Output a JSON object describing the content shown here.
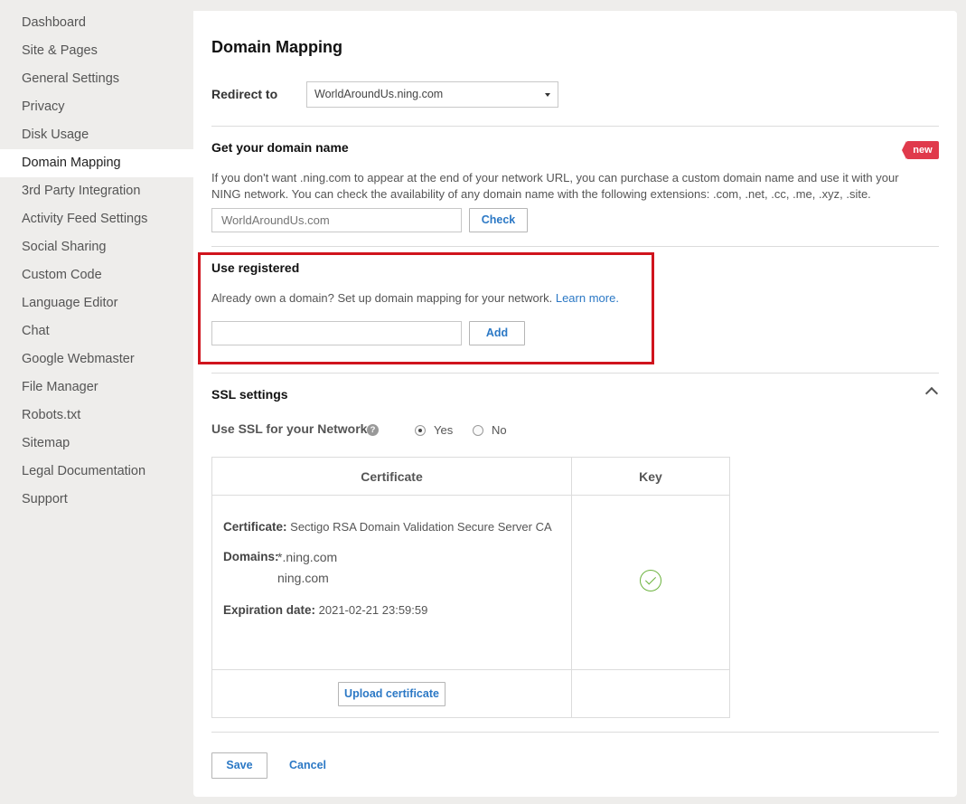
{
  "sidebar": {
    "items": [
      {
        "label": "Dashboard"
      },
      {
        "label": "Site & Pages"
      },
      {
        "label": "General Settings"
      },
      {
        "label": "Privacy"
      },
      {
        "label": "Disk Usage"
      },
      {
        "label": "Domain Mapping",
        "active": true
      },
      {
        "label": "3rd Party Integration"
      },
      {
        "label": "Activity Feed Settings"
      },
      {
        "label": "Social Sharing"
      },
      {
        "label": "Custom Code"
      },
      {
        "label": "Language Editor"
      },
      {
        "label": "Chat"
      },
      {
        "label": "Google Webmaster"
      },
      {
        "label": "File Manager"
      },
      {
        "label": "Robots.txt"
      },
      {
        "label": "Sitemap"
      },
      {
        "label": "Legal Documentation"
      },
      {
        "label": "Support"
      }
    ]
  },
  "main": {
    "title": "Domain Mapping",
    "redirect": {
      "label": "Redirect to",
      "selected": "WorldAroundUs.ning.com"
    },
    "get_domain": {
      "title": "Get your domain name",
      "badge": "new",
      "description_1": "If you don't want .ning.com to appear at the end of your network URL, you can purchase a custom domain name and use it with your",
      "description_2": "NING network. You can check the availability of any domain name with the following extensions: .com, .net, .cc, .me, .xyz, .site.",
      "input_placeholder": "WorldAroundUs.com",
      "check_label": "Check"
    },
    "use_registered": {
      "title": "Use registered",
      "description": "Already own a domain? Set up domain mapping for your network.",
      "learn_more": "Learn more.",
      "input_value": "",
      "add_label": "Add"
    },
    "ssl": {
      "title": "SSL settings",
      "use_ssl_label": "Use SSL for your Network",
      "help": "?",
      "options": [
        {
          "label": "Yes",
          "checked": true
        },
        {
          "label": "No",
          "checked": false
        }
      ],
      "table": {
        "col_certificate": "Certificate",
        "col_key": "Key",
        "certificate_label": "Certificate:",
        "certificate_value": "Sectigo RSA Domain Validation Secure Server CA",
        "domains_label": "Domains:",
        "domains": [
          "*.ning.com",
          "ning.com"
        ],
        "expiration_label": "Expiration date:",
        "expiration_value": "2021-02-21 23:59:59",
        "upload_label": "Upload certificate"
      }
    },
    "footer": {
      "save_label": "Save",
      "cancel_label": "Cancel"
    }
  }
}
